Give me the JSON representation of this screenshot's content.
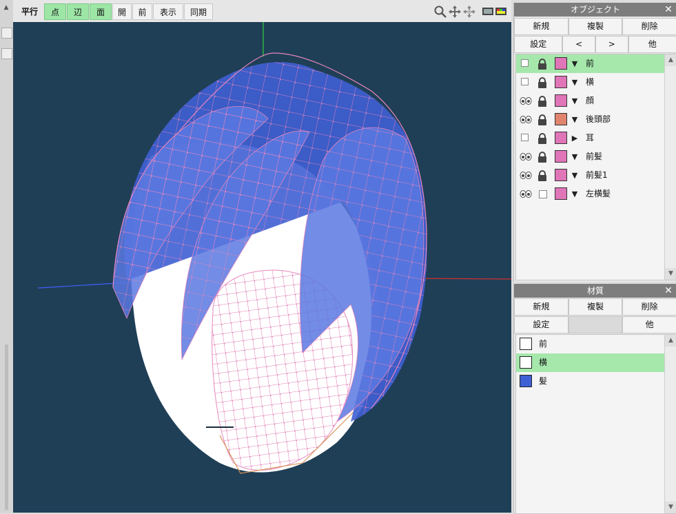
{
  "toolbar": {
    "projection": "平行",
    "mode_point": "点",
    "mode_edge": "辺",
    "mode_face": "面",
    "btn_open": "開",
    "btn_front": "前",
    "btn_display": "表示",
    "btn_sync": "同期",
    "icons": [
      "zoom-icon",
      "move-icon",
      "rotate-icon",
      "display-settings-icon"
    ]
  },
  "object_panel": {
    "title": "オブジェクト",
    "buttons_row1": [
      "新規",
      "複製",
      "削除"
    ],
    "buttons_row2": [
      "設定",
      "<",
      ">",
      "他"
    ],
    "items": [
      {
        "name": "前",
        "visible": false,
        "locked": true,
        "color": "#e075b8",
        "expanded": true,
        "selected": true
      },
      {
        "name": "横",
        "visible": false,
        "locked": true,
        "color": "#e075b8",
        "expanded": true,
        "selected": false
      },
      {
        "name": "顔",
        "visible": true,
        "locked": true,
        "color": "#e075b8",
        "expanded": true,
        "selected": false
      },
      {
        "name": "後頭部",
        "visible": true,
        "locked": true,
        "color": "#e0846e",
        "expanded": true,
        "selected": false
      },
      {
        "name": "耳",
        "visible": false,
        "locked": true,
        "color": "#e075b8",
        "expanded": false,
        "selected": false
      },
      {
        "name": "前髪",
        "visible": true,
        "locked": true,
        "color": "#e075b8",
        "expanded": true,
        "selected": false
      },
      {
        "name": "前髪1",
        "visible": true,
        "locked": true,
        "color": "#e075b8",
        "expanded": true,
        "selected": false
      },
      {
        "name": "左横髪",
        "visible": true,
        "locked": false,
        "color": "#e075b8",
        "expanded": true,
        "selected": false
      }
    ]
  },
  "material_panel": {
    "title": "材質",
    "buttons_row1": [
      "新規",
      "複製",
      "削除"
    ],
    "buttons_row2": [
      "設定",
      "",
      "他"
    ],
    "items": [
      {
        "name": "前",
        "color": "#ffffff",
        "selected": false
      },
      {
        "name": "横",
        "color": "#ffffff",
        "selected": true
      },
      {
        "name": "髪",
        "color": "#3f5fd4",
        "selected": false
      }
    ]
  },
  "colors": {
    "viewport_bg": "#1f3f56",
    "hair": "#4a66d8",
    "face": "#ffffff",
    "wire": "#e686bd",
    "selection": "#a6e8ac",
    "axis_y": "#2fd040",
    "axis_x": "#d03030",
    "axis_z": "#4060ff"
  }
}
